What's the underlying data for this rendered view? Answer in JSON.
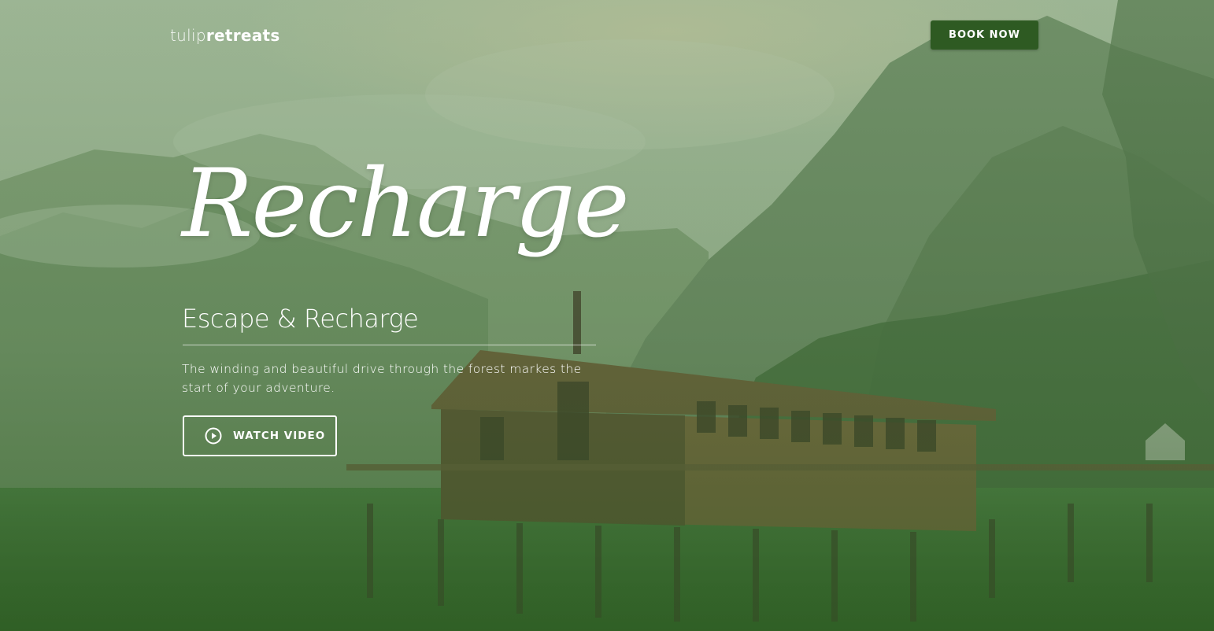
{
  "nav": {
    "logo_light": "tulip",
    "logo_bold": "retreats",
    "book_label": "BOOK NOW"
  },
  "hero": {
    "script_title": "Recharge",
    "subtitle": "Escape & Recharge",
    "description": "The winding and beautiful drive through the forest markes the start of your adventure.",
    "watch_label": "WATCH VIDEO",
    "watch_icon": "play-circle-icon"
  },
  "colors": {
    "accent": "#2e5a22",
    "overlay": "#3f6f35",
    "text": "#ffffff"
  }
}
